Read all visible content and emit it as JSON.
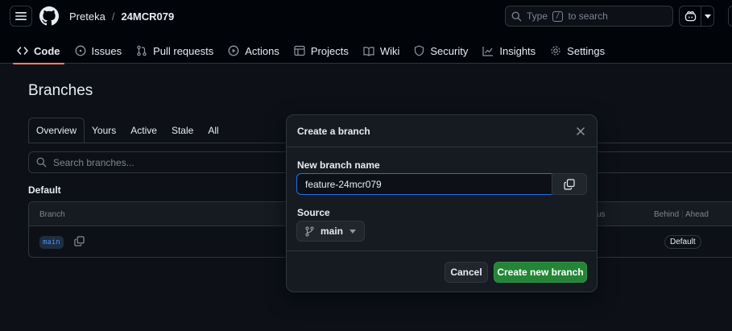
{
  "header": {
    "owner": "Preteka",
    "separator": "/",
    "repo": "24MCR079",
    "search": {
      "prefix": "Type",
      "key": "/",
      "suffix": "to search"
    }
  },
  "nav": {
    "tabs": [
      {
        "label": "Code",
        "icon": "code-icon",
        "active": true
      },
      {
        "label": "Issues",
        "icon": "issue-icon"
      },
      {
        "label": "Pull requests",
        "icon": "pull-request-icon"
      },
      {
        "label": "Actions",
        "icon": "play-icon"
      },
      {
        "label": "Projects",
        "icon": "table-icon"
      },
      {
        "label": "Wiki",
        "icon": "book-icon"
      },
      {
        "label": "Security",
        "icon": "shield-icon"
      },
      {
        "label": "Insights",
        "icon": "graph-icon"
      },
      {
        "label": "Settings",
        "icon": "gear-icon"
      }
    ]
  },
  "main": {
    "title": "Branches",
    "subtabs": [
      "Overview",
      "Yours",
      "Active",
      "Stale",
      "All"
    ],
    "search_placeholder": "Search branches...",
    "section_title": "Default",
    "table": {
      "headers": {
        "branch": "Branch",
        "status_fragment": "us",
        "behind": "Behind",
        "ahead": "Ahead"
      },
      "rows": [
        {
          "branch": "main",
          "badge": "Default"
        }
      ]
    }
  },
  "dialog": {
    "title": "Create a branch",
    "name_label": "New branch name",
    "name_value": "feature-24mcr079",
    "source_label": "Source",
    "source_value": "main",
    "cancel_label": "Cancel",
    "create_label": "Create new branch"
  },
  "colors": {
    "background": "#0d1117",
    "header_background": "#010409",
    "border": "#30363d",
    "accent_underline": "#f78166",
    "primary_button": "#238636",
    "focus_border": "#1f6feb",
    "link": "#4493f8"
  }
}
